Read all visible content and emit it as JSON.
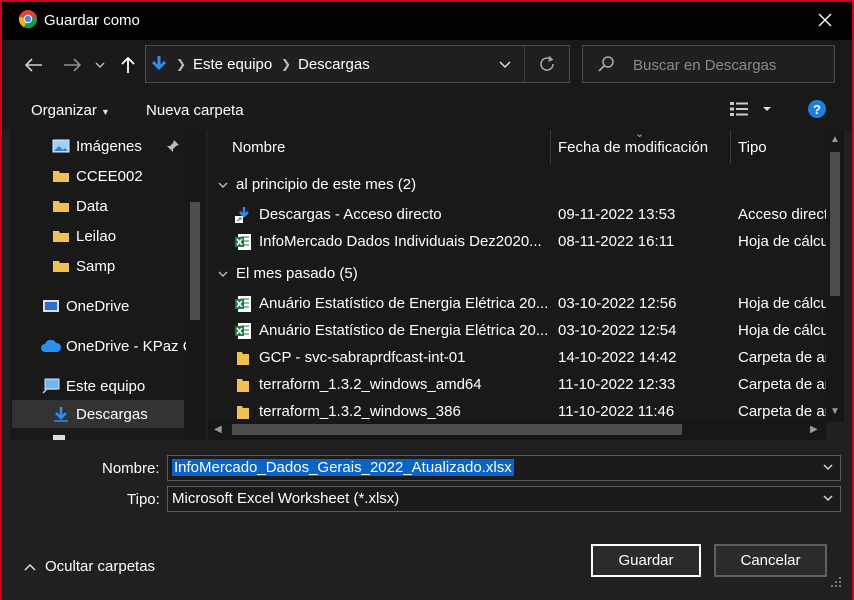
{
  "window": {
    "title": "Guardar como",
    "app_icon": "chrome-icon"
  },
  "nav": {
    "back_icon": "back-arrow-icon",
    "forward_icon": "forward-arrow-icon",
    "recent_icon": "chevron-down-icon",
    "up_icon": "up-arrow-icon",
    "breadcrumb": [
      "Este equipo",
      "Descargas"
    ],
    "search_placeholder": "Buscar en Descargas"
  },
  "commands": {
    "organize": "Organizar",
    "new_folder": "Nueva carpeta",
    "help": "?"
  },
  "sidebar": {
    "items": [
      {
        "label": "Imágenes",
        "icon": "pictures-icon",
        "pinned": true
      },
      {
        "label": "CCEE002",
        "icon": "folder-icon"
      },
      {
        "label": "Data",
        "icon": "folder-icon"
      },
      {
        "label": "Leilao",
        "icon": "folder-icon"
      },
      {
        "label": "Samp",
        "icon": "folder-icon"
      },
      {
        "label": "OneDrive",
        "icon": "onedrive-icon"
      },
      {
        "label": "OneDrive - KPaz C",
        "icon": "cloud-icon"
      },
      {
        "label": "Este equipo",
        "icon": "computer-icon"
      },
      {
        "label": "Descargas",
        "icon": "download-icon",
        "selected": true
      }
    ]
  },
  "columns": {
    "name": "Nombre",
    "date": "Fecha de modificación",
    "type": "Tipo"
  },
  "groups": [
    {
      "label": "al principio de este mes (2)",
      "files": [
        {
          "name": "Descargas - Acceso directo",
          "date": "09-11-2022 13:53",
          "type": "Acceso direct",
          "icon": "shortcut-icon"
        },
        {
          "name": "InfoMercado Dados Individuais Dez2020...",
          "date": "08-11-2022 16:11",
          "type": "Hoja de cálcu",
          "icon": "excel-icon"
        }
      ]
    },
    {
      "label": "El mes pasado (5)",
      "files": [
        {
          "name": "Anuário Estatístico de Energia Elétrica 20...",
          "date": "03-10-2022 12:56",
          "type": "Hoja de cálcu",
          "icon": "excel-icon"
        },
        {
          "name": "Anuário Estatístico de Energia Elétrica 20...",
          "date": "03-10-2022 12:54",
          "type": "Hoja de cálcu",
          "icon": "excel-icon"
        },
        {
          "name": "GCP - svc-sabraprdfcast-int-01",
          "date": "14-10-2022 14:42",
          "type": "Carpeta de ar",
          "icon": "folder-icon"
        },
        {
          "name": "terraform_1.3.2_windows_amd64",
          "date": "11-10-2022 12:33",
          "type": "Carpeta de ar",
          "icon": "folder-icon"
        },
        {
          "name": "terraform_1.3.2_windows_386",
          "date": "11-10-2022 11:46",
          "type": "Carpeta de ar",
          "icon": "folder-icon"
        }
      ]
    }
  ],
  "form": {
    "name_label": "Nombre:",
    "name_value": "InfoMercado_Dados_Gerais_2022_Atualizado.xlsx",
    "type_label": "Tipo:",
    "type_value": "Microsoft Excel Worksheet (*.xlsx)"
  },
  "buttons": {
    "save": "Guardar",
    "cancel": "Cancelar",
    "hide_folders": "Ocultar carpetas"
  },
  "colors": {
    "accent": "#0a64c8",
    "window_border": "#d0021b",
    "folder": "#f0c150",
    "excel": "#1d7a45",
    "help": "#1e7fe0"
  }
}
